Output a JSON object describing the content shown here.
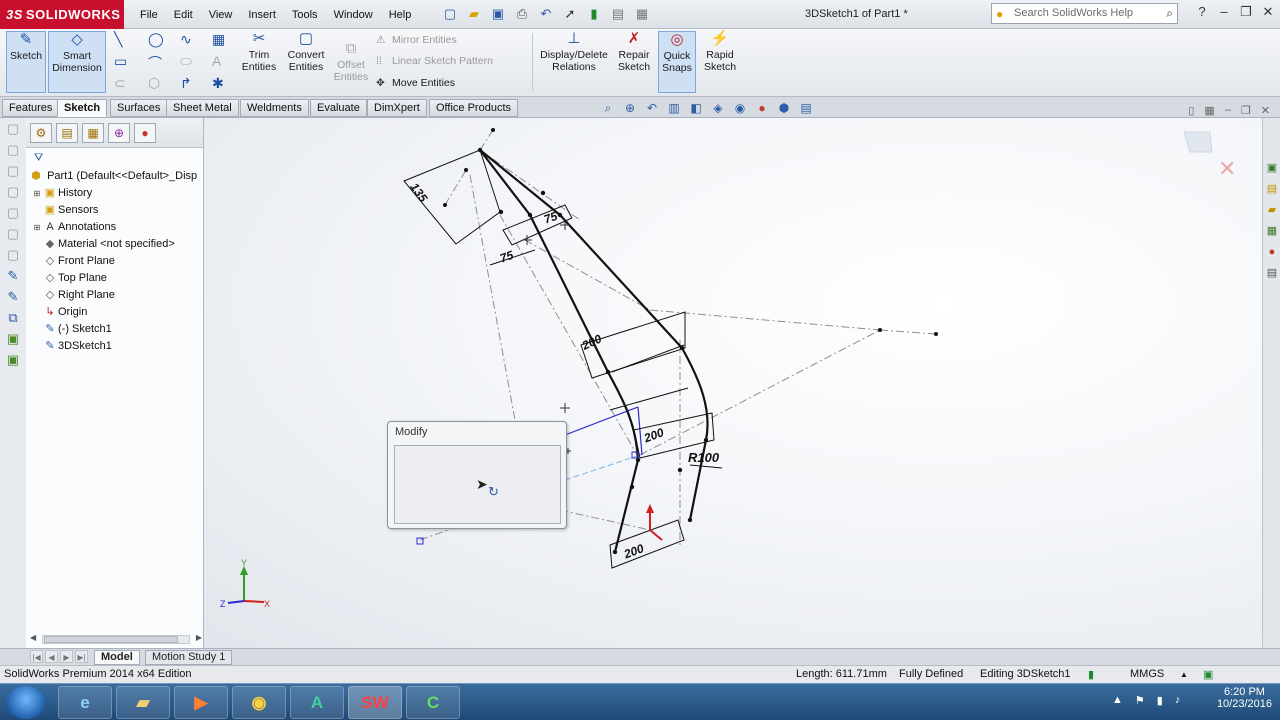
{
  "app": {
    "brand": "SOLIDWORKS",
    "doc_title": "3DSketch1 of Part1 *"
  },
  "menus": [
    "File",
    "Edit",
    "View",
    "Insert",
    "Tools",
    "Window",
    "Help"
  ],
  "search": {
    "placeholder": "Search SolidWorks Help"
  },
  "commands": {
    "sketch": "Sketch",
    "smart_dimension": [
      "Smart",
      "Dimension"
    ],
    "trim": [
      "Trim",
      "Entities"
    ],
    "convert": [
      "Convert",
      "Entities"
    ],
    "offset": [
      "Offset",
      "Entities"
    ],
    "mirror": "Mirror Entities",
    "linear_pattern": "Linear Sketch Pattern",
    "move": "Move Entities",
    "relations": [
      "Display/Delete",
      "Relations"
    ],
    "repair": [
      "Repair",
      "Sketch"
    ],
    "quick_snaps": [
      "Quick",
      "Snaps"
    ],
    "rapid": [
      "Rapid",
      "Sketch"
    ]
  },
  "tabs": [
    "Features",
    "Sketch",
    "Surfaces",
    "Sheet Metal",
    "Weldments",
    "Evaluate",
    "DimXpert",
    "Office Products"
  ],
  "active_tab": "Sketch",
  "tree": {
    "root": "Part1  (Default<<Default>_Disp",
    "items": [
      {
        "label": "History",
        "expand": true
      },
      {
        "label": "Sensors",
        "expand": false
      },
      {
        "label": "Annotations",
        "expand": true
      },
      {
        "label": "Material <not specified>",
        "expand": false
      },
      {
        "label": "Front Plane",
        "expand": false
      },
      {
        "label": "Top Plane",
        "expand": false
      },
      {
        "label": "Right Plane",
        "expand": false
      },
      {
        "label": "Origin",
        "expand": false
      },
      {
        "label": "(-) Sketch1",
        "expand": false
      },
      {
        "label": "3DSketch1",
        "expand": false
      }
    ]
  },
  "dimensions": {
    "d1": "135",
    "d2": "75",
    "d3": "75",
    "d4": "200",
    "d5": "200",
    "d6": "R100",
    "d7": "200"
  },
  "modify_dialog": {
    "title": "Modify"
  },
  "bottom_tabs": [
    "Model",
    "Motion Study 1"
  ],
  "status": {
    "edition": "SolidWorks Premium 2014 x64 Edition",
    "length": "Length: 611.71mm",
    "state": "Fully Defined",
    "editing": "Editing 3DSketch1",
    "units": "MMGS"
  },
  "clock": {
    "time": "6:20 PM",
    "date": "10/23/2016"
  },
  "colors": {
    "brand": "#c8102e",
    "sketch_line": "#111111",
    "construction": "#8a8a8a",
    "selected": "#2a2ad0"
  }
}
